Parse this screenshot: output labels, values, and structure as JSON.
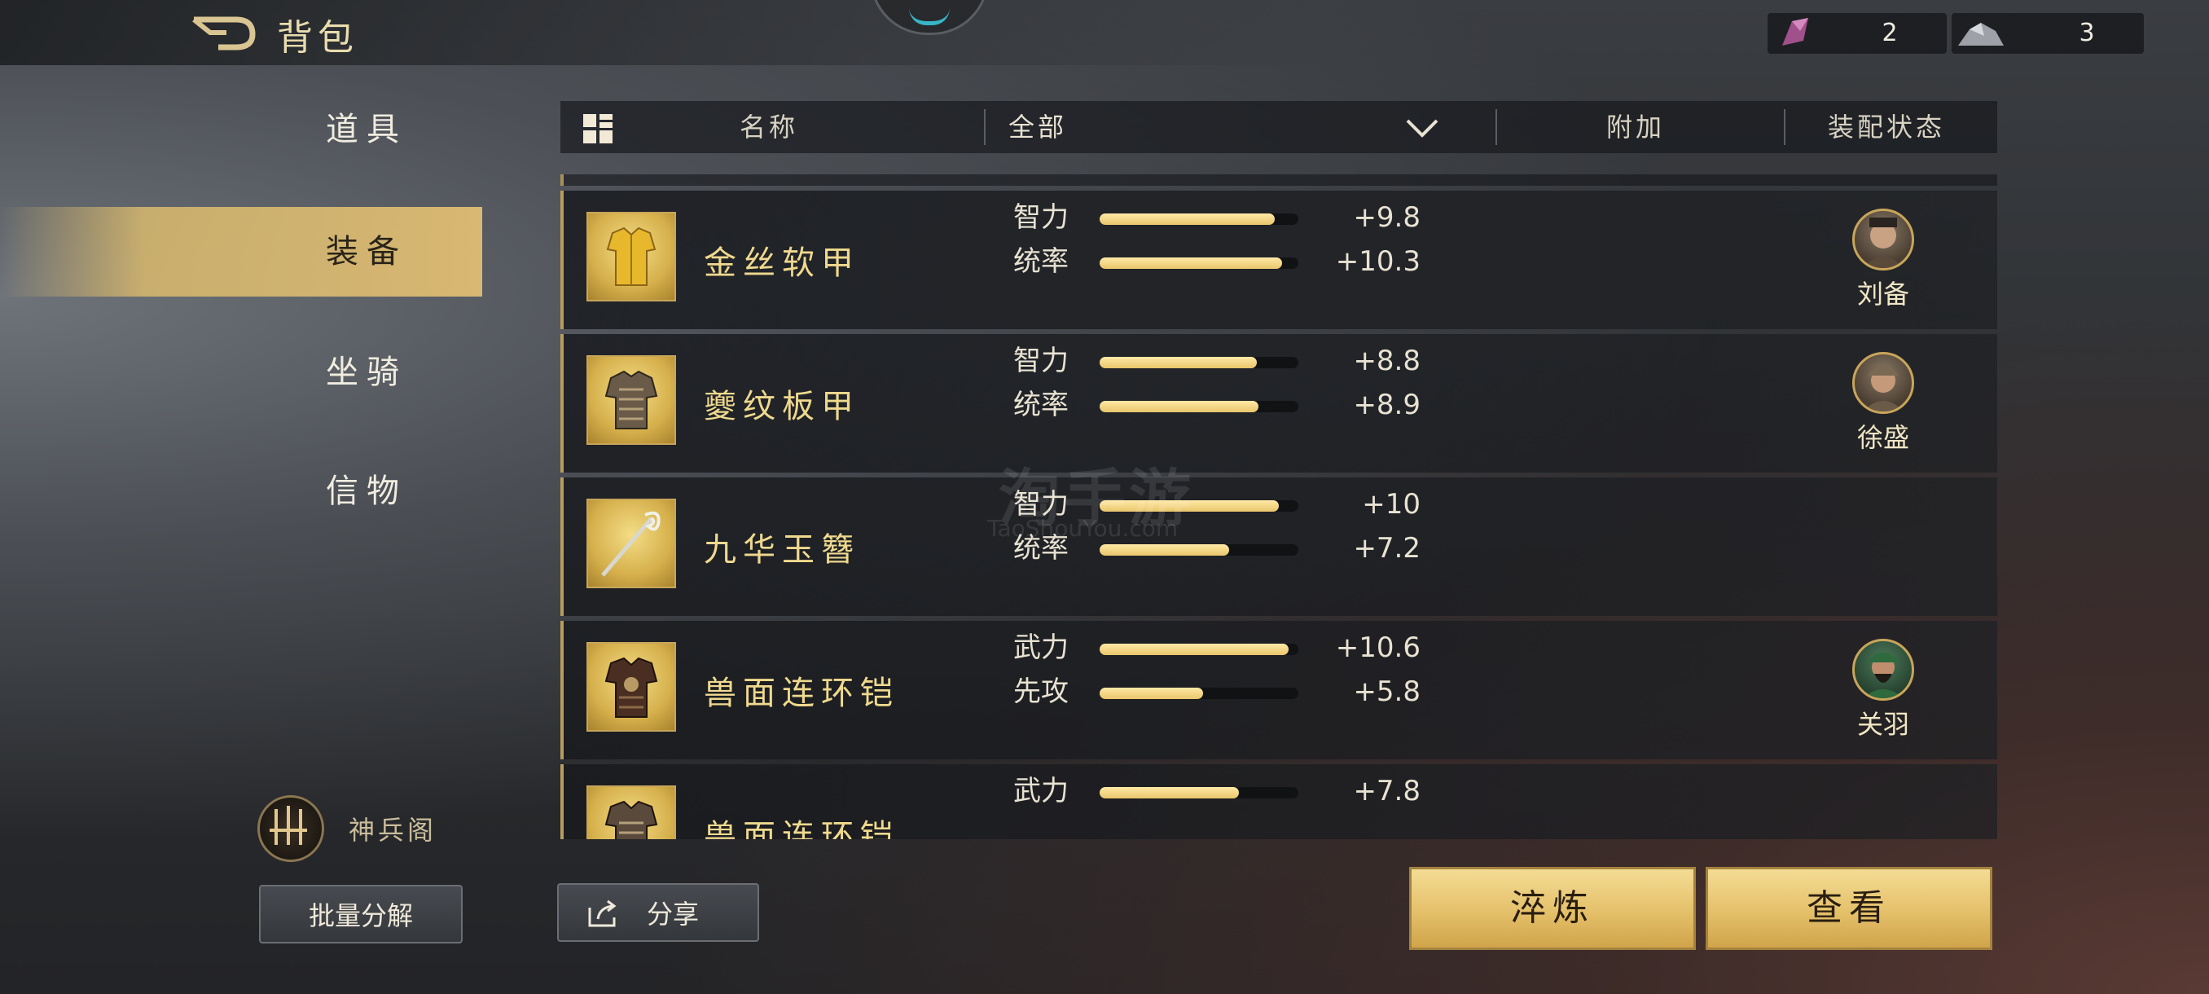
{
  "header": {
    "title": "背包",
    "currencies": [
      {
        "icon": "purple-crystal-icon",
        "value": "2"
      },
      {
        "icon": "silver-ore-icon",
        "value": "3"
      }
    ]
  },
  "nav": {
    "items": [
      {
        "label": "道具",
        "active": false
      },
      {
        "label": "装备",
        "active": true
      },
      {
        "label": "坐骑",
        "active": false
      },
      {
        "label": "信物",
        "active": false
      }
    ],
    "shenbing_label": "神兵阁",
    "batch_button": "批量分解"
  },
  "table": {
    "headers": {
      "name": "名称",
      "filter": "全部",
      "extra": "附加",
      "equip_status": "装配状态"
    },
    "rows": [
      {
        "name": "金丝软甲",
        "icon": "golden-soft-armor-icon",
        "stats": [
          {
            "name": "智力",
            "value": "+9.8",
            "fill": 0.88
          },
          {
            "name": "统率",
            "value": "+10.3",
            "fill": 0.92
          }
        ],
        "equipped_by": "刘备"
      },
      {
        "name": "夔纹板甲",
        "icon": "plate-armor-icon",
        "stats": [
          {
            "name": "智力",
            "value": "+8.8",
            "fill": 0.79
          },
          {
            "name": "统率",
            "value": "+8.9",
            "fill": 0.8
          }
        ],
        "equipped_by": "徐盛"
      },
      {
        "name": "九华玉簪",
        "icon": "jade-hairpin-icon",
        "stats": [
          {
            "name": "智力",
            "value": "+10",
            "fill": 0.9
          },
          {
            "name": "统率",
            "value": "+7.2",
            "fill": 0.65
          }
        ],
        "equipped_by": ""
      },
      {
        "name": "兽面连环铠",
        "icon": "chain-armor-icon",
        "stats": [
          {
            "name": "武力",
            "value": "+10.6",
            "fill": 0.95
          },
          {
            "name": "先攻",
            "value": "+5.8",
            "fill": 0.52
          }
        ],
        "equipped_by": "关羽"
      },
      {
        "name": "兽面连环铠",
        "icon": "chain-armor-icon",
        "stats": [
          {
            "name": "武力",
            "value": "+7.8",
            "fill": 0.7
          }
        ],
        "equipped_by": ""
      }
    ]
  },
  "footer": {
    "share": "分享",
    "refine": "淬炼",
    "view": "查看"
  },
  "watermark": {
    "main": "淘手游",
    "sub": "TaoShouYou.com"
  },
  "colors": {
    "gold": "#d8b872",
    "bar": "#f0d17c",
    "cyan": "#36b6c8"
  }
}
